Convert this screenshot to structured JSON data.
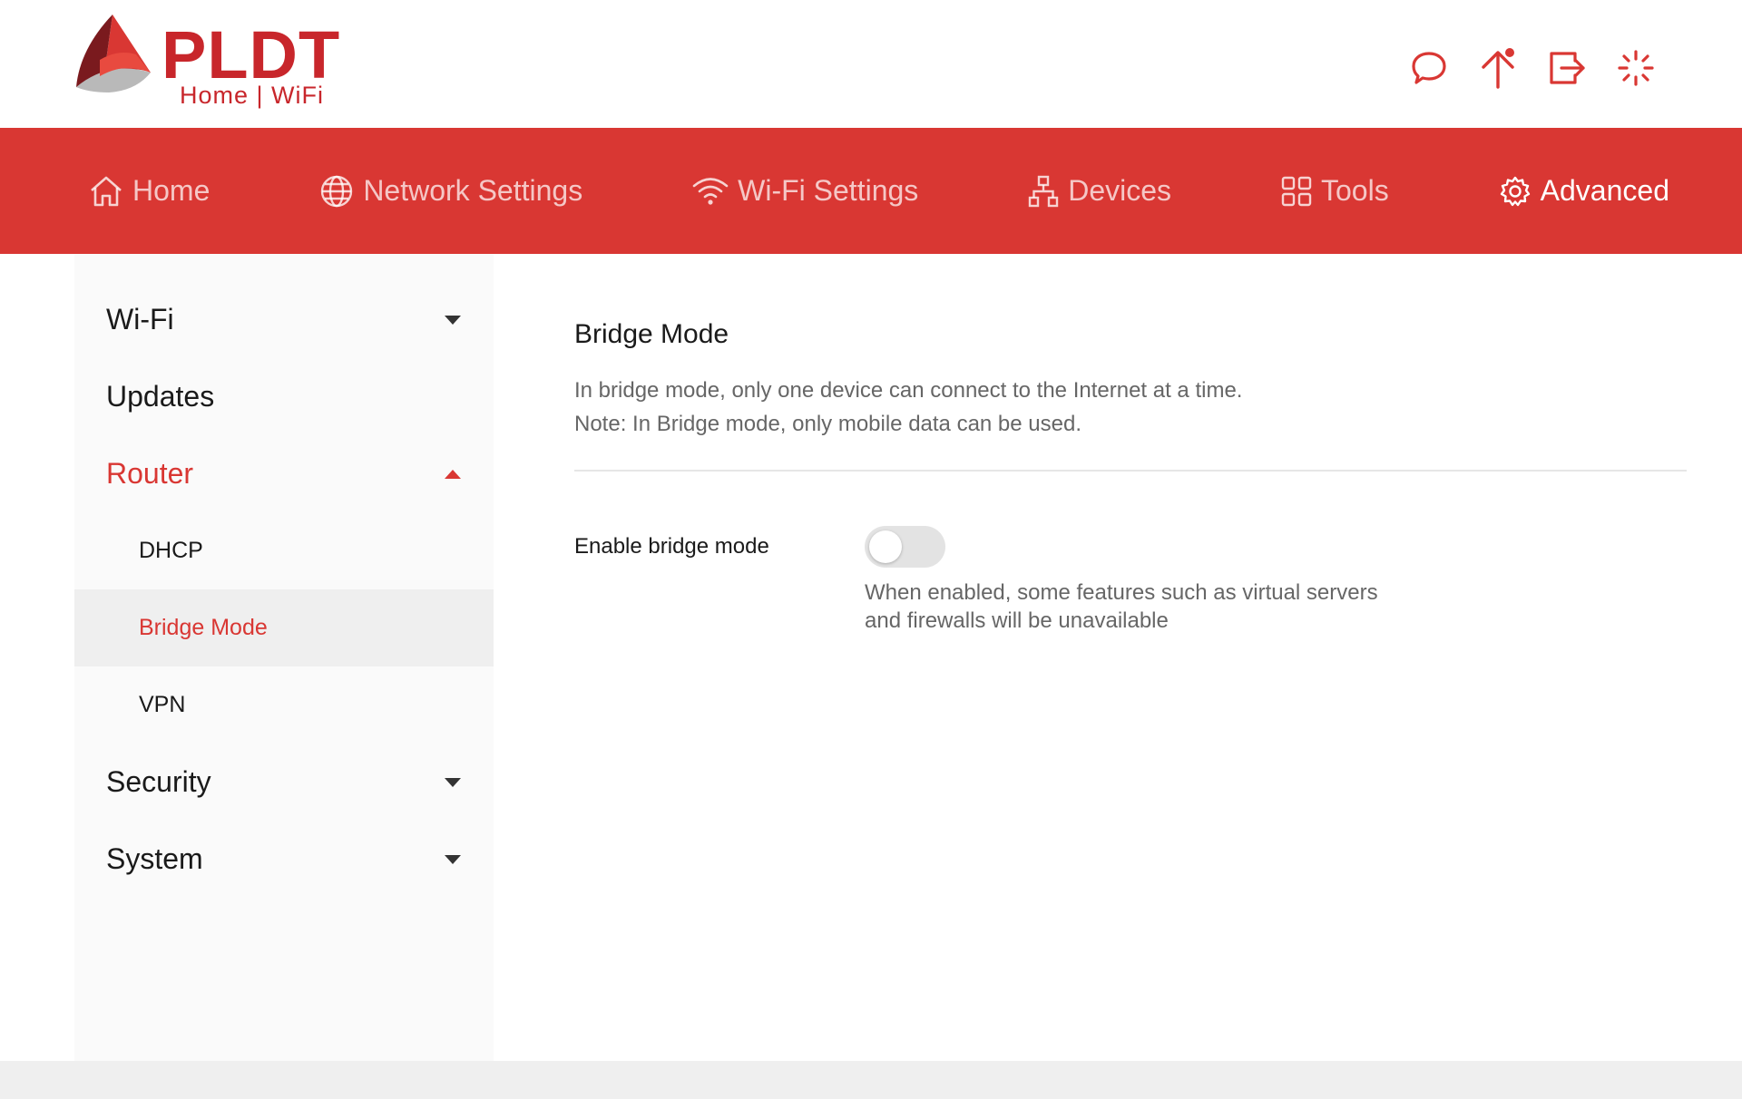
{
  "brand": {
    "name": "PLDT",
    "tagline": "Home | WiFi",
    "colors": {
      "primary": "#d93733",
      "logo_red": "#c8262b",
      "logo_dark": "#7a1a1e"
    }
  },
  "header": {
    "icons": [
      "chat-icon",
      "update-icon",
      "logout-icon",
      "loading-icon"
    ]
  },
  "nav": {
    "items": [
      {
        "label": "Home",
        "icon": "home-icon",
        "active": false
      },
      {
        "label": "Network Settings",
        "icon": "globe-icon",
        "active": false
      },
      {
        "label": "Wi-Fi Settings",
        "icon": "wifi-icon",
        "active": false
      },
      {
        "label": "Devices",
        "icon": "devices-icon",
        "active": false
      },
      {
        "label": "Tools",
        "icon": "tools-icon",
        "active": false
      },
      {
        "label": "Advanced",
        "icon": "gear-icon",
        "active": true
      }
    ]
  },
  "sidebar": {
    "items": [
      {
        "label": "Wi-Fi",
        "expandable": true,
        "expanded": false
      },
      {
        "label": "Updates",
        "expandable": false
      },
      {
        "label": "Router",
        "expandable": true,
        "expanded": true,
        "children": [
          {
            "label": "DHCP",
            "active": false
          },
          {
            "label": "Bridge Mode",
            "active": true
          },
          {
            "label": "VPN",
            "active": false
          }
        ]
      },
      {
        "label": "Security",
        "expandable": true,
        "expanded": false
      },
      {
        "label": "System",
        "expandable": true,
        "expanded": false
      }
    ]
  },
  "main": {
    "title": "Bridge Mode",
    "desc_line1": "In bridge mode, only one device can connect to the Internet at a time.",
    "desc_line2": "Note: In Bridge mode, only mobile data can be used.",
    "field_label": "Enable bridge mode",
    "toggle_on": false,
    "hint_line1": "When enabled, some features such as virtual servers",
    "hint_line2": "and firewalls will be unavailable"
  }
}
